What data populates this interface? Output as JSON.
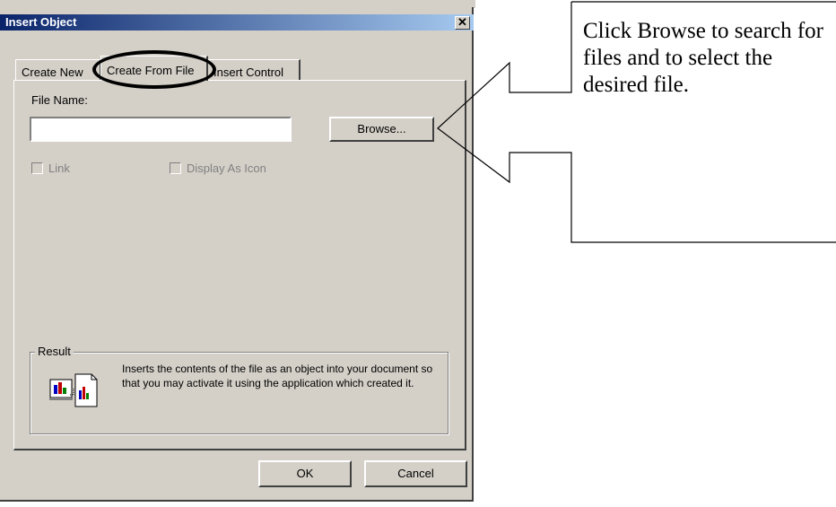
{
  "window": {
    "title": "Insert Object",
    "close_label": "✕"
  },
  "tabs": [
    {
      "label": "Create New",
      "active": false
    },
    {
      "label": "Create From File",
      "active": true
    },
    {
      "label": "Insert Control",
      "active": false
    }
  ],
  "form": {
    "file_name_label": "File Name:",
    "file_name_value": "",
    "browse_label": "Browse...",
    "link_label": "Link",
    "display_as_icon_label": "Display As Icon"
  },
  "result": {
    "label": "Result",
    "text": "Inserts the contents of the file as an object into your document so that you may activate it using the application which created it.",
    "icon": "insert-file-icon"
  },
  "footer": {
    "ok_label": "OK",
    "cancel_label": "Cancel"
  },
  "callout": {
    "text": "Click Browse to search for files and to select the desired file."
  },
  "colors": {
    "dialog_bg": "#d4d0c8",
    "titlebar": "#0a246a"
  }
}
